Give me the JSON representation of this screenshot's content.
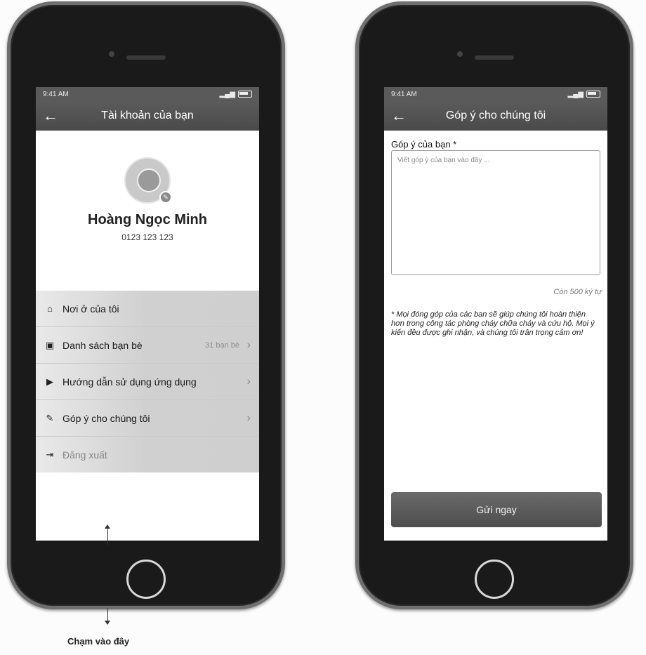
{
  "left_screen": {
    "status_time": "9:41 AM",
    "nav_title": "Tài khoản của bạn",
    "profile": {
      "name": "Hoàng Ngọc Minh",
      "phone": "0123 123 123"
    },
    "menu": [
      {
        "label": "Nơi ở của tôi",
        "icon": "home-icon"
      },
      {
        "label": "Danh sách bạn bè",
        "icon": "contacts-icon",
        "count": "31 bạn bè"
      },
      {
        "label": "Hướng dẫn sử dụng ứng dụng",
        "icon": "guide-icon"
      },
      {
        "label": "Góp ý cho chúng tôi",
        "icon": "feedback-icon"
      },
      {
        "label": "Đăng xuất",
        "icon": "logout-icon"
      }
    ]
  },
  "right_screen": {
    "status_time": "9:41 AM",
    "nav_title": "Góp ý cho chúng tôi",
    "form_label": "Góp ý của bạn *",
    "textarea_placeholder": "Viết góp ý của bạn vào đây ...",
    "char_count": "Còn 500 ký tự",
    "note": "* Mọi đóng góp của các bạn sẽ giúp chúng tôi hoàn thiện hơn trong công tác phòng cháy chữa cháy và cứu hộ. Mọi ý kiến đều được ghi nhận, và chúng tôi trân trọng cảm ơn!",
    "submit_label": "Gửi ngay"
  },
  "annotation": {
    "caption": "Chạm vào đây"
  }
}
